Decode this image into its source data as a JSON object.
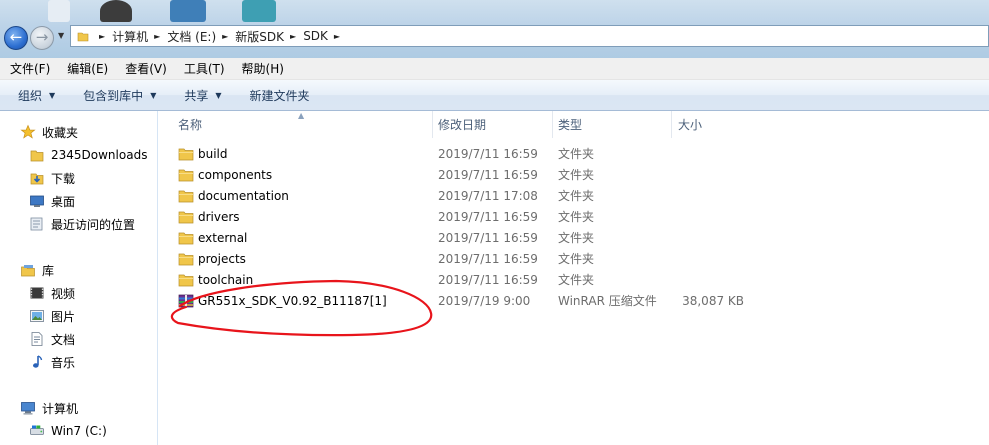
{
  "address_bar": {
    "breadcrumbs": [
      "计算机",
      "文档 (E:)",
      "新版SDK",
      "SDK"
    ],
    "back_icon": "back-arrow-icon",
    "forward_icon": "forward-arrow-icon"
  },
  "menu": [
    "文件(F)",
    "编辑(E)",
    "查看(V)",
    "工具(T)",
    "帮助(H)"
  ],
  "commands": [
    {
      "label": "组织",
      "dropdown": true
    },
    {
      "label": "包含到库中",
      "dropdown": true
    },
    {
      "label": "共享",
      "dropdown": true
    },
    {
      "label": "新建文件夹",
      "dropdown": false
    }
  ],
  "nav": {
    "favorites": {
      "label": "收藏夹",
      "items": [
        "2345Downloads",
        "下载",
        "桌面",
        "最近访问的位置"
      ]
    },
    "libraries": {
      "label": "库",
      "items": [
        "视频",
        "图片",
        "文档",
        "音乐"
      ]
    },
    "computer": {
      "label": "计算机",
      "items": [
        "Win7 (C:)"
      ]
    }
  },
  "columns": [
    "名称",
    "修改日期",
    "类型",
    "大小"
  ],
  "files": [
    {
      "name": "build",
      "date": "2019/7/11 16:59",
      "type": "文件夹",
      "size": "",
      "icon": "folder-icon"
    },
    {
      "name": "components",
      "date": "2019/7/11 16:59",
      "type": "文件夹",
      "size": "",
      "icon": "folder-icon"
    },
    {
      "name": "documentation",
      "date": "2019/7/11 17:08",
      "type": "文件夹",
      "size": "",
      "icon": "folder-icon"
    },
    {
      "name": "drivers",
      "date": "2019/7/11 16:59",
      "type": "文件夹",
      "size": "",
      "icon": "folder-icon"
    },
    {
      "name": "external",
      "date": "2019/7/11 16:59",
      "type": "文件夹",
      "size": "",
      "icon": "folder-icon"
    },
    {
      "name": "projects",
      "date": "2019/7/11 16:59",
      "type": "文件夹",
      "size": "",
      "icon": "folder-icon"
    },
    {
      "name": "toolchain",
      "date": "2019/7/11 16:59",
      "type": "文件夹",
      "size": "",
      "icon": "folder-icon"
    },
    {
      "name": "GR551x_SDK_V0.92_B11187[1]",
      "date": "2019/7/19 9:00",
      "type": "WinRAR 压缩文件",
      "size": "38,087 KB",
      "icon": "winrar-archive-icon"
    }
  ],
  "colors": {
    "annotation": "#e8141b",
    "folder": "#f0c64a",
    "header_text": "#4c607a"
  }
}
